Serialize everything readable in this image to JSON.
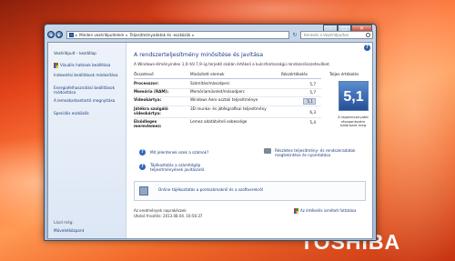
{
  "desktop": {
    "brand": "TOSHIBA"
  },
  "window": {
    "controls": {
      "minimize": "–",
      "maximize": "□",
      "close": "✕"
    },
    "address": [
      "Minden vezérlőpultelem",
      "Teljesítményadatok és -eszközök"
    ],
    "address_sep": "▸",
    "search_placeholder": "Keresés a Vezérlőpulton"
  },
  "sidebar": {
    "home": "Vezérlőpult – kezdőlap",
    "links": [
      "Vizuális hatások beállítása",
      "Indexelési beállítások módosítása",
      "Energiafelhasználási beállítások módosítása",
      "A lemezkarbantartó megnyitása",
      "Speciális eszközök"
    ],
    "see_also": "Lásd még:",
    "see_also_link": "Műveletközpont"
  },
  "main": {
    "help": "?",
    "title": "A rendszerteljesítmény minősítése és javítása",
    "description": "A Windows-élményindex 1,0–tól 7,9–ig terjedő skálán értékeli a kulcsfontosságú rendszerösszetevőket.",
    "headers": {
      "component": "Összetevő",
      "rated": "Minősített elemek",
      "subscore": "Részértékelés",
      "base": "Teljes értékelés"
    },
    "rows": [
      {
        "component": "Processzor:",
        "rated": "Számítás/másodperc",
        "score": "5,7"
      },
      {
        "component": "Memória (RAM):",
        "rated": "Memóriaművelet/másodperc",
        "score": "5,7"
      },
      {
        "component": "Videokártya:",
        "rated": "Windows Aero asztali teljesítménye",
        "score": "5,1"
      },
      {
        "component": "Játékra szolgáló videokártya:",
        "rated": "3D munka- és játékgrafikai teljesítmény",
        "score": "6,3"
      },
      {
        "component": "Elsődleges merevlemez:",
        "rated": "Lemez adatátviteli sebessége",
        "score": "5,4"
      }
    ],
    "overall_score": "5,1",
    "overall_note": "A legalacsonyabb részpontszám határozza meg",
    "links_left": [
      "Mit jelentenek ezek a számok?",
      "Tájékoztatás a számítógép teljesítményének javításáról."
    ],
    "link_right": "Részletes teljesítmény- és rendszeradatok megtekintése és nyomtatása",
    "online_box": "Online tájékoztatás a pontszámokról és a szoftverekről",
    "footer_line1": "Az eredmények naprakészek",
    "footer_line2": "Utolsó frissítés: 2013.08.04. 16:56:37",
    "rerun": "Az értékelés ismételt futtatása"
  }
}
